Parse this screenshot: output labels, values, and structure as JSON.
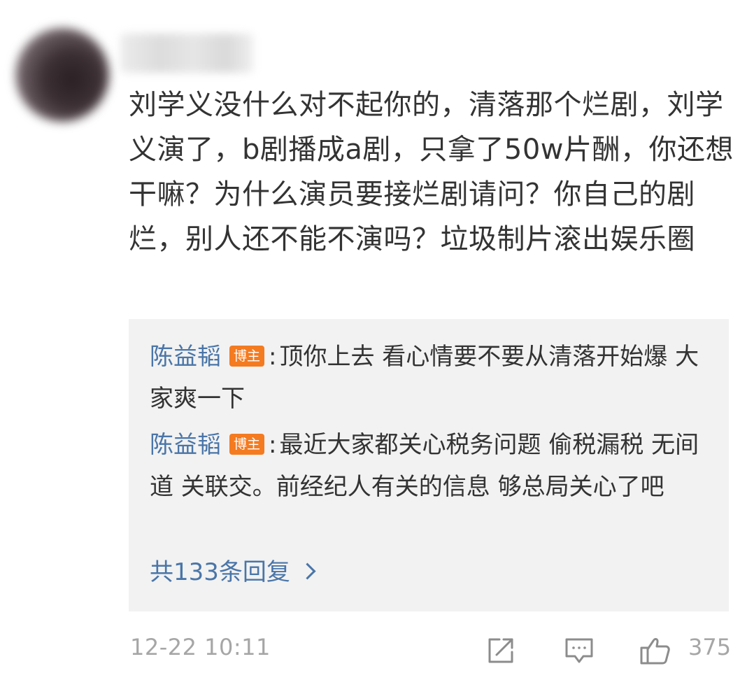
{
  "comment": {
    "text": "刘学义没什么对不起你的，清落那个烂剧，刘学义演了，b剧播成a剧，只拿了50w片酬，你还想干嘛？为什么演员要接烂剧请问？你自己的剧烂，别人还不能不演吗？垃圾制片滚出娱乐圈",
    "timestamp": "12-22 10:11",
    "like_count": "375"
  },
  "replies": [
    {
      "author": "陈益韬",
      "badge": "博主",
      "separator": ":",
      "text": "顶你上去 看心情要不要从清落开始爆 大家爽一下"
    },
    {
      "author": "陈益韬",
      "badge": "博主",
      "separator": ":",
      "text": "最近大家都关心税务问题 偷税漏税 无间道 关联交。前经纪人有关的信息 够总局关心了吧"
    }
  ],
  "more_replies": {
    "label": "共133条回复"
  },
  "icons": {
    "share": "share-icon",
    "comment": "comment-icon",
    "like": "thumbs-up-icon",
    "more": "chevron-right-icon"
  },
  "colors": {
    "text": "#333333",
    "link": "#4a75a8",
    "badge": "#f47b20",
    "muted": "#a6a6a6",
    "reply_bg": "#f2f2f2"
  }
}
